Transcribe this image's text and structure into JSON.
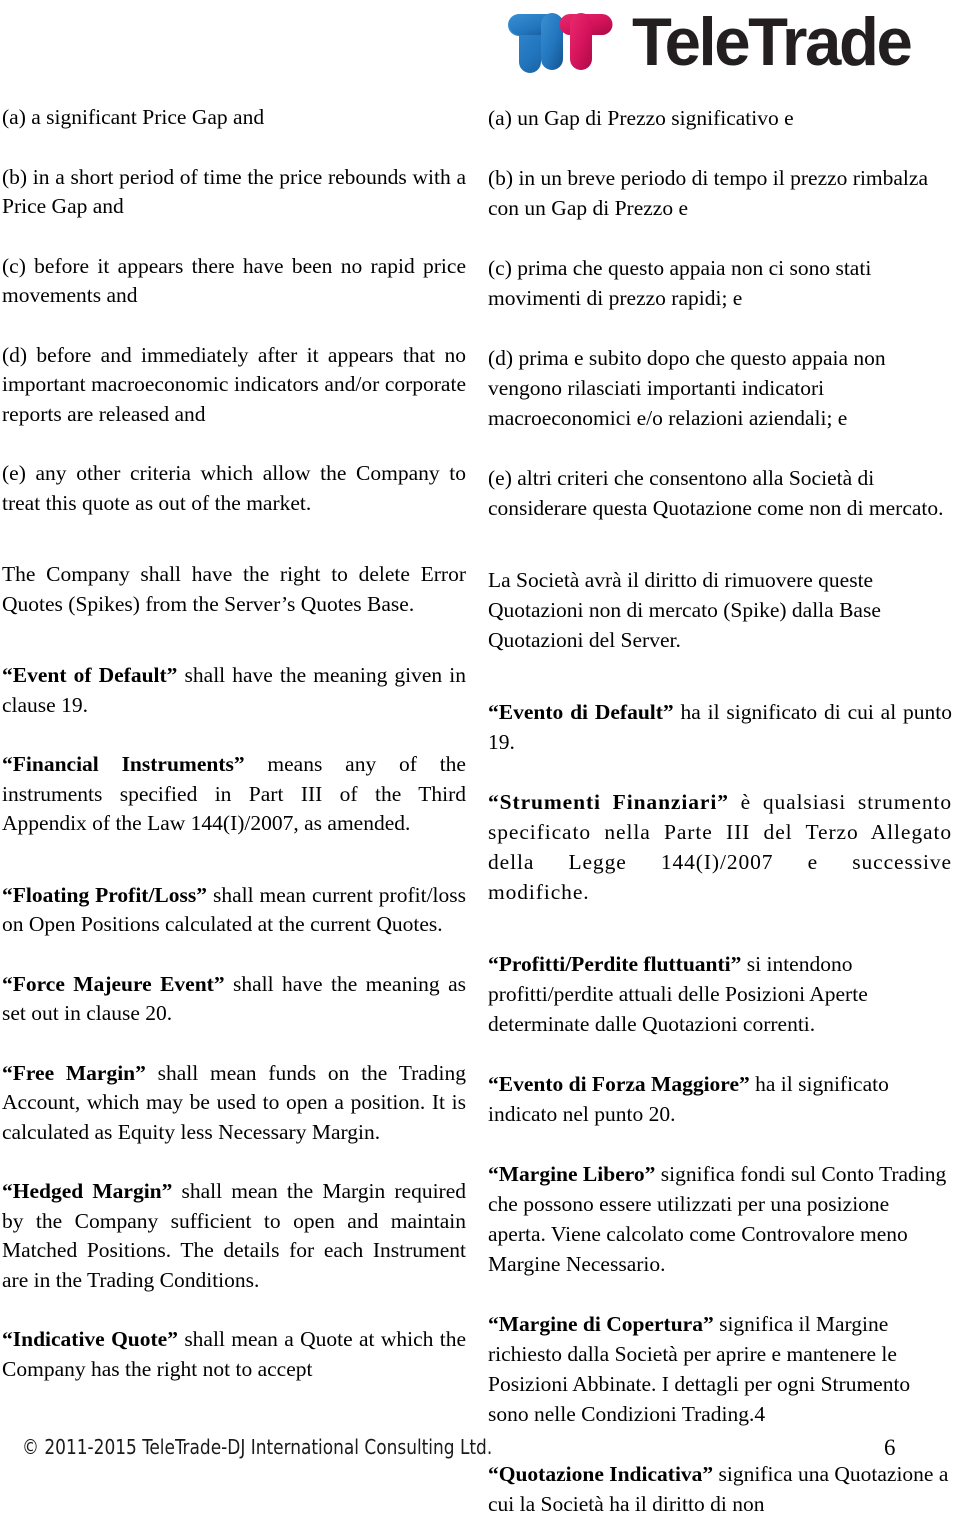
{
  "header": {
    "logo": {
      "mark_name": "teletrade-double-t-mark",
      "wordmark": "TeleTrade",
      "colors": {
        "blue_light": "#2f82c9",
        "blue_dark": "#15538f",
        "pink_light": "#e31c63",
        "pink_dark": "#b10a47",
        "wordmark": "#231f20"
      }
    }
  },
  "left_column": {
    "language": "English",
    "paragraphs": [
      {
        "id": "item-a",
        "text": "(a)  a significant Price Gap and"
      },
      {
        "id": "item-b",
        "text": "(b) in a short period of time the price rebounds with a Price Gap and"
      },
      {
        "id": "item-c",
        "text": "(c) before it appears there have been no rapid price movements and"
      },
      {
        "id": "item-d",
        "text": "(d) before and immediately after it appears that no important macroeconomic indicators and/or corporate reports are released and"
      },
      {
        "id": "item-e",
        "text": "(e) any other criteria which allow the Company to treat this quote as out of the market."
      },
      {
        "id": "delete-error-quotes",
        "text": "The Company shall have the right to delete Error Quotes (Spikes) from the Server’s Quotes Base."
      }
    ],
    "definitions": [
      {
        "id": "event-of-default",
        "term": "“Event of Default”",
        "body": " shall have the meaning given in clause 19."
      },
      {
        "id": "financial-instruments",
        "term": "“Financial Instruments”",
        "body": " means any of the instruments specified in Part III of the Third Appendix of the Law 144(I)/2007, as amended."
      },
      {
        "id": "floating-profit-loss",
        "term": "“Floating Profit/Loss”",
        "body": " shall mean current profit/loss on Open Positions calculated at the current Quotes."
      },
      {
        "id": "force-majeure-event",
        "term": "“Force Majeure Event”",
        "body": " shall have the meaning as set out in clause 20."
      },
      {
        "id": "free-margin",
        "term": "“Free Margin”",
        "body": " shall mean funds on the Trading Account, which may be used to open a position. It is calculated as Equity less Necessary Margin."
      },
      {
        "id": "hedged-margin",
        "term": "“Hedged Margin”",
        "body": " shall mean the Margin required by the Company sufficient to open and maintain Matched Positions. The details for each Instrument are in the Trading Conditions."
      },
      {
        "id": "indicative-quote",
        "term": "“Indicative    Quote”",
        "body": " shall mean a Quote at which the Company has the right not to  accept"
      }
    ]
  },
  "right_column": {
    "language": "Italian",
    "paragraphs": [
      {
        "id": "item-a-it",
        "text": "(a) un Gap di Prezzo significativo e"
      },
      {
        "id": "item-b-it",
        "text": "(b) in un breve periodo di tempo il prezzo rimbalza con un Gap di Prezzo e"
      },
      {
        "id": "item-c-it",
        "text": "(c) prima che questo appaia non ci sono stati movimenti di prezzo rapidi; e"
      },
      {
        "id": "item-d-it",
        "text": "(d) prima e subito dopo che questo appaia non vengono rilasciati importanti indicatori macroeconomici e/o relazioni aziendali; e"
      },
      {
        "id": "item-e-it",
        "text": "(e) altri criteri che consentono alla Società di considerare questa Quotazione come non di mercato."
      },
      {
        "id": "delete-error-quotes-it",
        "text": "La Società avrà il diritto di rimuovere queste Quotazioni non di mercato (Spike) dalla Base Quotazioni del Server."
      }
    ],
    "definitions": [
      {
        "id": "evento-di-default",
        "term": "“Evento di Default”",
        "body": " ha il significato di cui al punto 19."
      },
      {
        "id": "strumenti-finanziari",
        "term": "“Strumenti       Finanziari”",
        "body": " è   qualsiasi strumento specificato nella Parte III del Terzo Allegato della Legge 144(I)/2007 e successive modifiche."
      },
      {
        "id": "profitti-perdite-fluttuanti",
        "term": "“Profitti/Perdite fluttuanti”",
        "body": " si intendono profitti/perdite attuali delle Posizioni Aperte determinate dalle Quotazioni correnti."
      },
      {
        "id": "evento-di-forza-maggiore",
        "term": "“Evento di Forza Maggiore”",
        "body": " ha il significato indicato nel punto 20."
      },
      {
        "id": "margine-libero",
        "term": "“Margine Libero”",
        "body": " significa fondi sul Conto Trading che possono essere utilizzati per una posizione aperta. Viene calcolato come Controvalore meno Margine Necessario."
      },
      {
        "id": "margine-di-copertura",
        "term": "“Margine di Copertura”",
        "body": " significa il Margine richiesto dalla Società per aprire e mantenere le Posizioni Abbinate. I dettagli per ogni Strumento sono nelle Condizioni Trading.4"
      },
      {
        "id": "quotazione-indicativa",
        "term": "“Quotazione Indicativa”",
        "body": " significa una Quotazione a cui la Società ha il diritto di non"
      }
    ]
  },
  "footer": {
    "copyright": "© 2011-2015 TeleTrade-DJ International Consulting Ltd.",
    "page_number": "6"
  }
}
